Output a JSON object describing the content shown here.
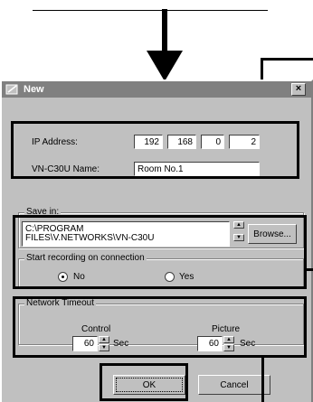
{
  "dialog": {
    "title": "New",
    "close_glyph": "×",
    "ip_label": "IP Address:",
    "ip_octets": [
      "192",
      "168",
      "0",
      "2"
    ],
    "name_label": "VN-C30U Name:",
    "name_value": "Room No.1",
    "save_group": "Save in:",
    "save_path_line1": "C:\\PROGRAM",
    "save_path_line2": "FILES\\V.NETWORKS\\VN-C30U",
    "browse_label": "Browse...",
    "start_group": "Start recording on connection",
    "radio_no": "No",
    "radio_yes": "Yes",
    "timeout_group": "Network Timeout",
    "control_label": "Control",
    "control_value": "60",
    "control_unit": "Sec",
    "picture_label": "Picture",
    "picture_value": "60",
    "picture_unit": "Sec",
    "ok_label": "OK",
    "cancel_label": "Cancel"
  },
  "icons": {
    "arrow": "down-arrow-icon",
    "title": "new-window-icon",
    "spin_up": "▲",
    "spin_down": "▼"
  },
  "colors": {
    "dialog_bg": "#c0c0c0",
    "titlebar": "#808080",
    "highlight": "#000000"
  }
}
